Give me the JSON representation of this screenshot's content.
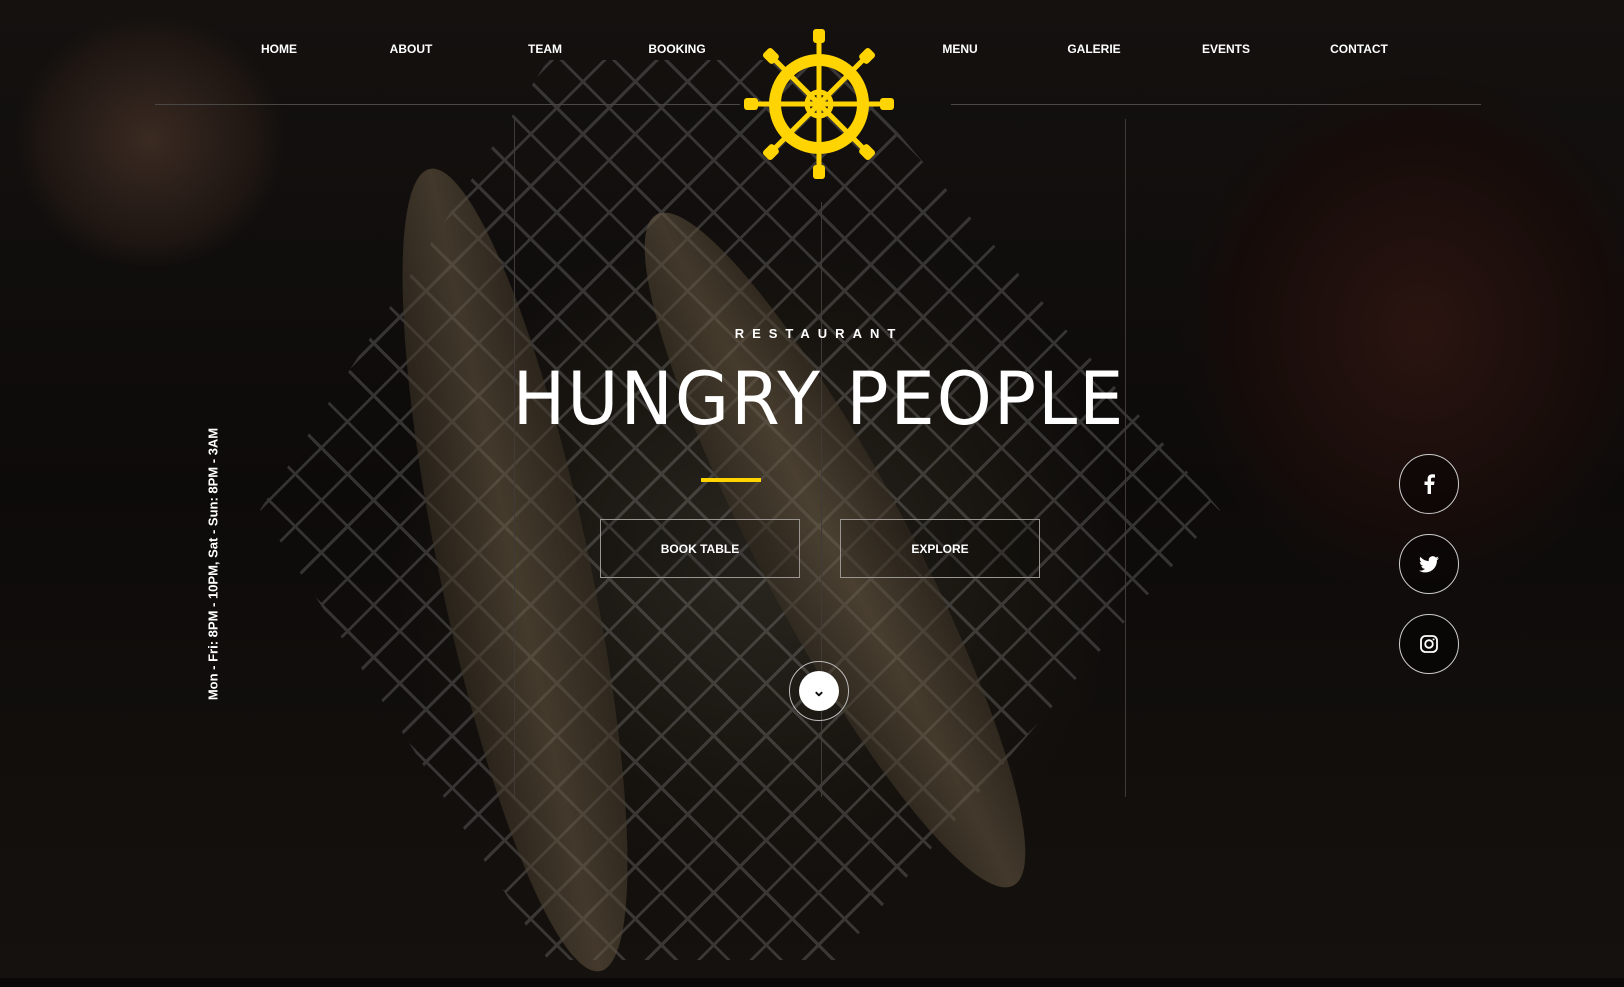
{
  "nav": {
    "left": [
      "HOME",
      "ABOUT",
      "TEAM",
      "BOOKING"
    ],
    "right": [
      "MENU",
      "GALERIE",
      "EVENTS",
      "CONTACT"
    ]
  },
  "hero": {
    "subtitle": "RESTAURANT",
    "title": "HUNGRY PEOPLE",
    "book_label": "BOOK TABLE",
    "explore_label": "EXPLORE"
  },
  "hours": "Mon - Fri: 8PM - 10PM, Sat - Sun: 8PM - 3AM",
  "social": [
    "facebook-icon",
    "twitter-icon",
    "instagram-icon"
  ],
  "colors": {
    "accent": "#ffd400"
  }
}
